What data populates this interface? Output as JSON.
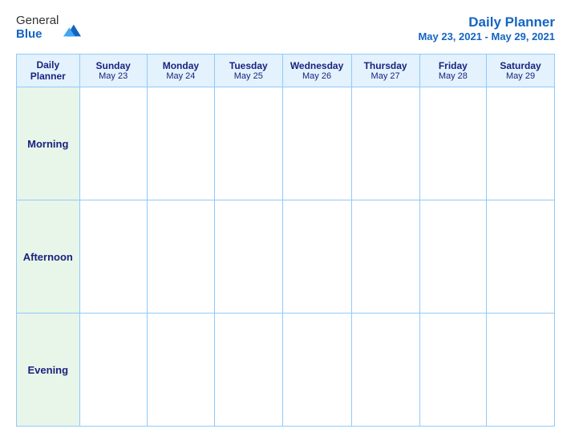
{
  "logo": {
    "general": "General",
    "blue": "Blue",
    "icon_color": "#1565c0"
  },
  "title": {
    "main": "Daily Planner",
    "date_range": "May 23, 2021 - May 29, 2021"
  },
  "header_col": {
    "label": "Daily Planner"
  },
  "days": [
    {
      "name": "Sunday",
      "date": "May 23"
    },
    {
      "name": "Monday",
      "date": "May 24"
    },
    {
      "name": "Tuesday",
      "date": "May 25"
    },
    {
      "name": "Wednesday",
      "date": "May 26"
    },
    {
      "name": "Thursday",
      "date": "May 27"
    },
    {
      "name": "Friday",
      "date": "May 28"
    },
    {
      "name": "Saturday",
      "date": "May 29"
    }
  ],
  "rows": [
    {
      "label": "Morning"
    },
    {
      "label": "Afternoon"
    },
    {
      "label": "Evening"
    }
  ]
}
